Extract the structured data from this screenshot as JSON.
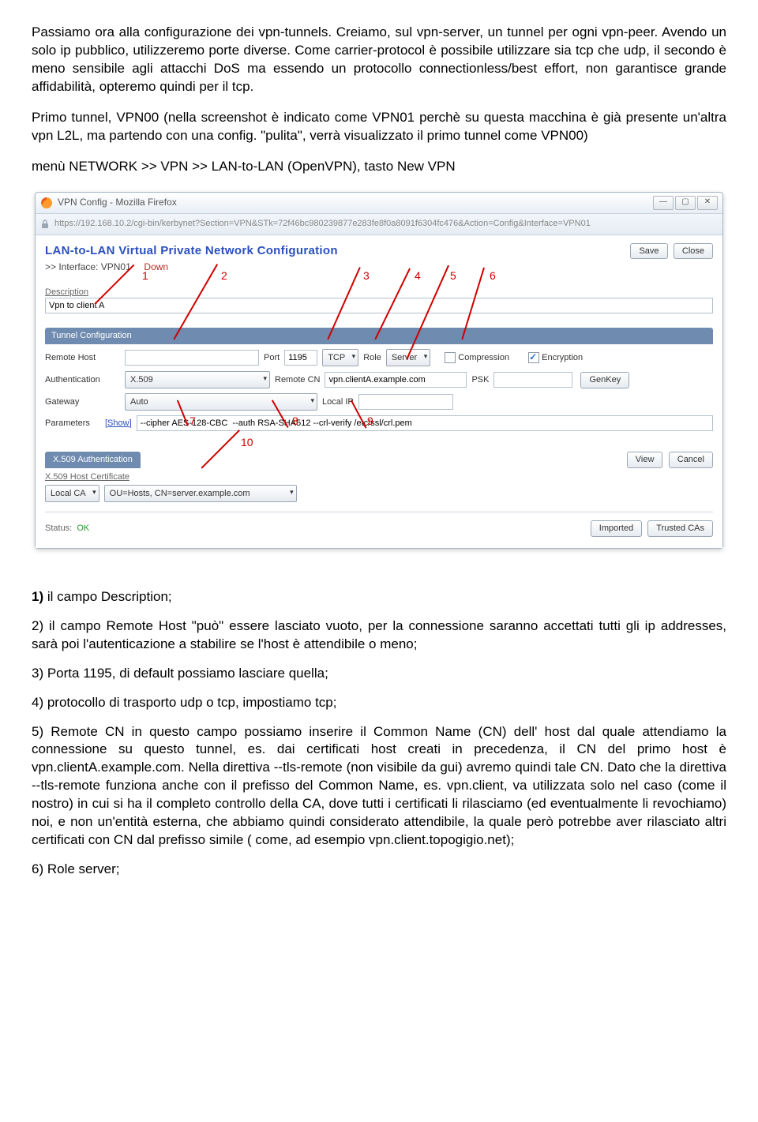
{
  "intro": {
    "p1": "Passiamo ora alla configurazione dei vpn-tunnels. Creiamo, sul vpn-server, un tunnel per ogni vpn-peer. Avendo un solo ip pubblico, utilizzeremo porte diverse. Come carrier-protocol è possibile utilizzare sia tcp che udp, il secondo è meno sensibile agli attacchi DoS ma essendo un protocollo connectionless/best effort, non garantisce grande affidabilità, opteremo quindi per il tcp.",
    "p2": "Primo tunnel, VPN00 (nella screenshot è indicato come VPN01 perchè su questa macchina è già presente un'altra vpn L2L, ma partendo con una config. \"pulita\", verrà visualizzato il primo tunnel come VPN00)",
    "menu": "menù NETWORK >> VPN >> LAN-to-LAN (OpenVPN), tasto New VPN"
  },
  "window": {
    "title": "VPN Config - Mozilla Firefox",
    "url": "https://192.168.10.2/cgi-bin/kerbynet?Section=VPN&STk=72f46bc980239877e283fe8f0a8091f6304fc476&Action=Config&Interface=VPN01",
    "winbtns": {
      "min": "—",
      "max": "▢",
      "close": "✕"
    }
  },
  "config": {
    "title": "LAN-to-LAN Virtual Private Network Configuration",
    "save": "Save",
    "close": "Close",
    "iface_prefix": ">> Interface: ",
    "iface": "VPN01",
    "iface_status": "Down",
    "description_label": "Description",
    "description_value": "Vpn to client A",
    "tunnel_tab": "Tunnel Configuration",
    "remote_host_label": "Remote Host",
    "remote_host_value": "",
    "port_label": "Port",
    "port_value": "1195",
    "proto_value": "TCP",
    "role_label": "Role",
    "role_value": "Server",
    "compression_label": "Compression",
    "encryption_label": "Encryption",
    "auth_label": "Authentication",
    "auth_value": "X.509",
    "remotecn_label": "Remote CN",
    "remotecn_value": "vpn.clientA.example.com",
    "psk_label": "PSK",
    "psk_value": "",
    "genkey": "GenKey",
    "gateway_label": "Gateway",
    "gateway_value": "Auto",
    "localip_label": "Local IP",
    "localip_value": "",
    "params_label": "Parameters",
    "params_show": "[Show]",
    "params_value": "--cipher AES-128-CBC  --auth RSA-SHA512 --crl-verify /etc/ssl/crl.pem",
    "x509_tab": "X.509 Authentication",
    "view": "View",
    "cancel": "Cancel",
    "x509_cert_label": "X.509 Host Certificate",
    "x509_ca": "Local CA",
    "x509_dn": "OU=Hosts, CN=server.example.com",
    "status_label": "Status:",
    "status_value": "OK",
    "imported": "Imported",
    "trusted": "Trusted CAs"
  },
  "annotations": {
    "n1": "1",
    "n2": "2",
    "n3": "3",
    "n4": "4",
    "n5": "5",
    "n6": "6",
    "n7": "7",
    "n8": "8",
    "n9": "9",
    "n10": "10"
  },
  "list": {
    "i1": "1) il campo Description;",
    "i2": "2) il campo Remote Host \"può\" essere lasciato vuoto, per la connessione saranno accettati tutti gli ip addresses, sarà poi l'autenticazione a stabilire se l'host è attendibile o meno;",
    "i3": "3) Porta  1195, di default possiamo lasciare quella;",
    "i4": "4) protocollo di trasporto udp o tcp, impostiamo tcp;",
    "i5": "5) Remote CN in questo campo possiamo inserire il Common Name (CN) dell' host dal quale attendiamo la connessione su questo tunnel, es. dai certificati host creati in precedenza, il CN del primo host è vpn.clientA.example.com. Nella direttiva  --tls-remote (non visibile da gui) avremo quindi tale CN. Dato che la direttiva --tls-remote funziona anche con il prefisso del Common Name, es. vpn.client, va utilizzata  solo nel caso (come il nostro) in cui si ha il completo controllo della CA, dove tutti i certificati li rilasciamo (ed eventualmente li revochiamo) noi, e non un'entità esterna, che abbiamo quindi considerato attendibile, la quale però potrebbe aver rilasciato altri certificati con CN dal prefisso simile ( come, ad esempio vpn.client.topogigio.net);",
    "i6": "6) Role server;"
  }
}
